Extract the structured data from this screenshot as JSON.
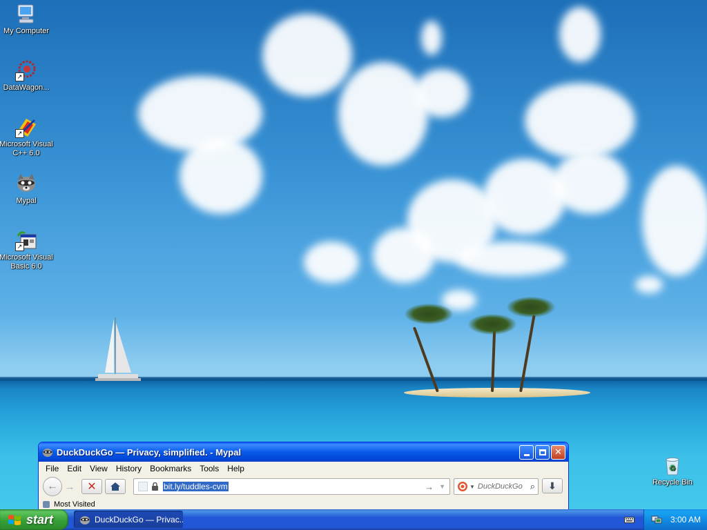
{
  "desktop": {
    "icons": [
      {
        "label": "My Computer",
        "icon": "my-computer-icon"
      },
      {
        "label": "DataWagon...",
        "icon": "datawagon-icon"
      },
      {
        "label": "Microsoft Visual C++ 6.0",
        "icon": "visual-cpp-icon"
      },
      {
        "label": "Mypal",
        "icon": "mypal-icon"
      },
      {
        "label": "Microsoft Visual Basic 6.0",
        "icon": "visual-basic-icon"
      }
    ],
    "recycle_bin": {
      "label": "Recycle Bin",
      "icon": "recycle-bin-icon"
    }
  },
  "browser": {
    "title": "DuckDuckGo — Privacy, simplified. - Mypal",
    "menu": {
      "file": "File",
      "edit": "Edit",
      "view": "View",
      "history": "History",
      "bookmarks": "Bookmarks",
      "tools": "Tools",
      "help": "Help"
    },
    "url": "bit.ly/tuddles-cvm",
    "search_placeholder": "DuckDuckGo",
    "bookmarks_bar": {
      "most_visited": "Most Visited"
    }
  },
  "taskbar": {
    "start_label": "start",
    "task_item": "DuckDuckGo — Privac...",
    "clock": "3:00 AM"
  },
  "colors": {
    "title_bar": "#0a5ae8",
    "taskbar": "#2157d7",
    "start_button": "#37a037",
    "tray": "#0f86e0",
    "url_selection": "#3169c6"
  }
}
